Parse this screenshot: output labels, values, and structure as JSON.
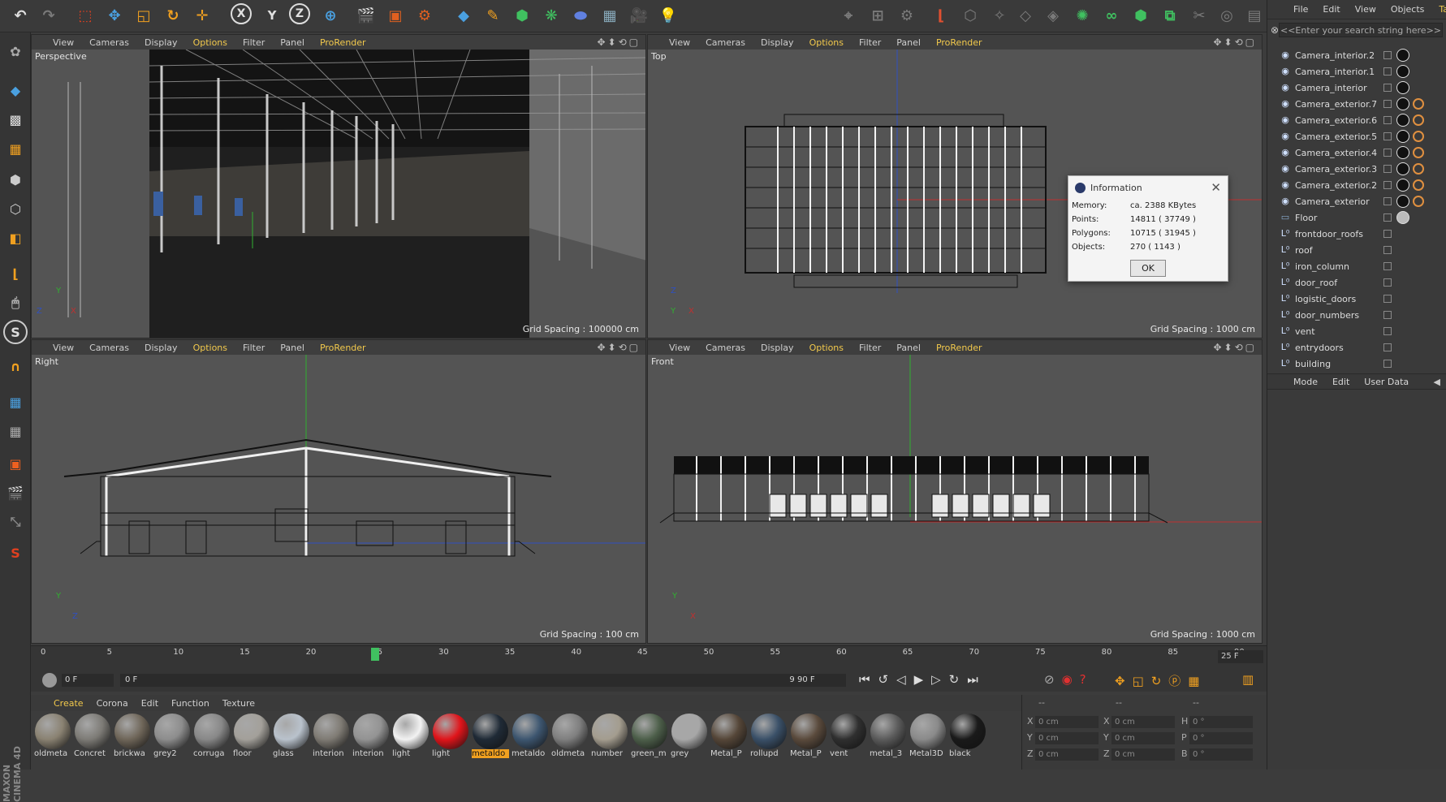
{
  "viewport_menu": {
    "view": "View",
    "cameras": "Cameras",
    "display": "Display",
    "options": "Options",
    "filter": "Filter",
    "panel": "Panel",
    "prorender": "ProRender"
  },
  "viewports": {
    "perspective": {
      "label": "Perspective",
      "grid": "Grid Spacing : 100000 cm"
    },
    "top": {
      "label": "Top",
      "grid": "Grid Spacing : 1000 cm"
    },
    "right": {
      "label": "Right",
      "grid": "Grid Spacing : 100 cm"
    },
    "front": {
      "label": "Front",
      "grid": "Grid Spacing : 1000 cm"
    }
  },
  "axes": {
    "x": "X",
    "y": "Y",
    "z": "Z"
  },
  "object_manager": {
    "menu": [
      "File",
      "Edit",
      "View",
      "Objects",
      "Tags"
    ],
    "search_placeholder": "<<Enter your search string here>>",
    "objects": [
      {
        "name": "Camera_interior.2",
        "type": "camera"
      },
      {
        "name": "Camera_interior.1",
        "type": "camera"
      },
      {
        "name": "Camera_interior",
        "type": "camera"
      },
      {
        "name": "Camera_exterior.7",
        "type": "camera"
      },
      {
        "name": "Camera_exterior.6",
        "type": "camera"
      },
      {
        "name": "Camera_exterior.5",
        "type": "camera"
      },
      {
        "name": "Camera_exterior.4",
        "type": "camera"
      },
      {
        "name": "Camera_exterior.3",
        "type": "camera"
      },
      {
        "name": "Camera_exterior.2",
        "type": "camera"
      },
      {
        "name": "Camera_exterior",
        "type": "camera"
      },
      {
        "name": "Floor",
        "type": "floor"
      },
      {
        "name": "frontdoor_roofs",
        "type": "null"
      },
      {
        "name": "roof",
        "type": "null"
      },
      {
        "name": "iron_column",
        "type": "null"
      },
      {
        "name": "door_roof",
        "type": "null"
      },
      {
        "name": "logistic_doors",
        "type": "null"
      },
      {
        "name": "door_numbers",
        "type": "null"
      },
      {
        "name": "vent",
        "type": "null"
      },
      {
        "name": "entrydoors",
        "type": "null"
      },
      {
        "name": "building",
        "type": "null"
      }
    ]
  },
  "attribute_manager": {
    "menu": [
      "Mode",
      "Edit",
      "User Data"
    ]
  },
  "info_dialog": {
    "title": "Information",
    "rows": [
      {
        "k": "Memory:",
        "v": "ca. 2388 KBytes"
      },
      {
        "k": "Points:",
        "v": "14811 ( 37749 )"
      },
      {
        "k": "Polygons:",
        "v": "10715 ( 31945 )"
      },
      {
        "k": "Objects:",
        "v": "270 ( 1143 )"
      }
    ],
    "ok": "OK"
  },
  "timeline": {
    "ticks": [
      "0",
      "5",
      "10",
      "15",
      "20",
      "25",
      "30",
      "35",
      "40",
      "45",
      "50",
      "55",
      "60",
      "65",
      "70",
      "75",
      "80",
      "85",
      "90"
    ],
    "current_frame": 25,
    "max": 90,
    "frame_rate_field": "25 F"
  },
  "transport": {
    "start": "0 F",
    "range_start": "0 F",
    "range_end": "90 F",
    "end": "90 F"
  },
  "material_menu": [
    "Create",
    "Corona",
    "Edit",
    "Function",
    "Texture"
  ],
  "materials": [
    {
      "name": "oldmeta",
      "color": "#8a8272"
    },
    {
      "name": "Concret",
      "color": "#7d7b76"
    },
    {
      "name": "brickwa",
      "color": "#6f6659"
    },
    {
      "name": "grey2",
      "color": "#8d8d8d"
    },
    {
      "name": "corruga",
      "color": "#888888"
    },
    {
      "name": "floor",
      "color": "#a3a09a"
    },
    {
      "name": "glass",
      "color": "#b9c2cc"
    },
    {
      "name": "interion",
      "color": "#7f7b74"
    },
    {
      "name": "interion",
      "color": "#939393"
    },
    {
      "name": "light",
      "color": "#f2f2f2"
    },
    {
      "name": "light",
      "color": "#e0141a"
    },
    {
      "name": "metaldo",
      "color": "#1f2a36"
    },
    {
      "name": "metaldo",
      "color": "#3d5670"
    },
    {
      "name": "oldmeta",
      "color": "#7f7f7f"
    },
    {
      "name": "number",
      "color": "#a49d8f"
    },
    {
      "name": "green_m",
      "color": "#4d5f4a"
    },
    {
      "name": "grey",
      "color": "#a7a7a7"
    },
    {
      "name": "Metal_P",
      "color": "#554638"
    },
    {
      "name": "rollupd",
      "color": "#3a5068"
    },
    {
      "name": "Metal_P",
      "color": "#5a4a3c"
    },
    {
      "name": "vent",
      "color": "#2f2f2f"
    },
    {
      "name": "metal_3",
      "color": "#5b5b5b"
    },
    {
      "name": "Metal3D",
      "color": "#8a8a8a"
    },
    {
      "name": "black",
      "color": "#1a1a1a"
    }
  ],
  "coords": {
    "rows": [
      {
        "a": "X",
        "av": "0 cm",
        "b": "X",
        "bv": "0 cm",
        "c": "H",
        "cv": "0 °"
      },
      {
        "a": "Y",
        "av": "0 cm",
        "b": "Y",
        "bv": "0 cm",
        "c": "P",
        "cv": "0 °"
      },
      {
        "a": "Z",
        "av": "0 cm",
        "b": "Z",
        "bv": "0 cm",
        "c": "B",
        "cv": "0 °"
      }
    ],
    "header": "--"
  },
  "brand": "MAXON CINEMA 4D",
  "colors": {
    "accent": "#f2c94c",
    "active_material": "#f0a020",
    "axis_x": "#c03030",
    "axis_y": "#30b030",
    "axis_z": "#3050c0"
  }
}
